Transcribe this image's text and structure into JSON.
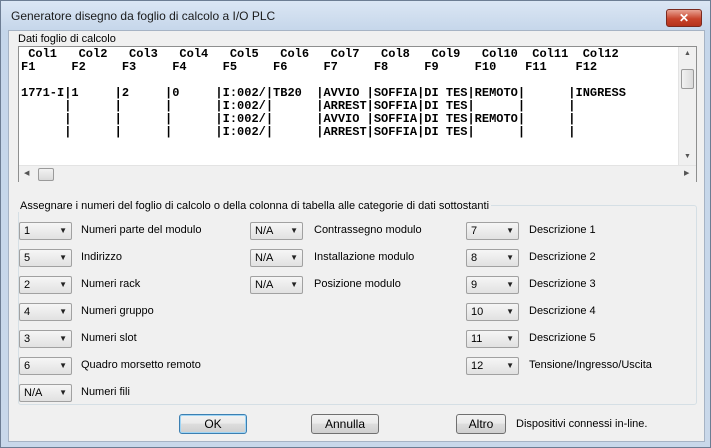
{
  "window": {
    "title": "Generatore disegno da foglio di calcolo a I/O PLC"
  },
  "icons": {
    "close": "close-icon",
    "scroll_up": "arrow-up-icon",
    "scroll_down": "arrow-down-icon",
    "scroll_left": "arrow-left-icon",
    "scroll_right": "arrow-right-icon",
    "dropdown": "chevron-down-icon"
  },
  "sheet": {
    "label": "Dati foglio di calcolo",
    "lines": [
      " Col1   Col2   Col3   Col4   Col5   Col6   Col7   Col8   Col9   Col10  Col11  Col12",
      "F1     F2     F3     F4     F5     F6     F7     F8     F9     F10    F11    F12",
      "",
      "1771-I|1     |2     |0     |I:002/|TB20  |AVVIO |SOFFIA|DI TES|REMOTO|      |INGRESS",
      "      |      |      |      |I:002/|      |ARREST|SOFFIA|DI TES|      |      |",
      "      |      |      |      |I:002/|      |AVVIO |SOFFIA|DI TES|REMOTO|      |",
      "      |      |      |      |I:002/|      |ARREST|SOFFIA|DI TES|      |      |"
    ]
  },
  "assign": {
    "title": "Assegnare i numeri del foglio di calcolo o della colonna di tabella alle categorie di dati sottostanti",
    "col1": [
      {
        "value": "1",
        "label": "Numeri parte del modulo"
      },
      {
        "value": "5",
        "label": "Indirizzo"
      },
      {
        "value": "2",
        "label": "Numeri rack"
      },
      {
        "value": "4",
        "label": "Numeri gruppo"
      },
      {
        "value": "3",
        "label": "Numeri slot"
      },
      {
        "value": "6",
        "label": "Quadro morsetto remoto"
      },
      {
        "value": "N/A",
        "label": "Numeri fili"
      }
    ],
    "col2": [
      {
        "value": "N/A",
        "label": "Contrassegno modulo"
      },
      {
        "value": "N/A",
        "label": "Installazione modulo"
      },
      {
        "value": "N/A",
        "label": "Posizione modulo"
      }
    ],
    "col3": [
      {
        "value": "7",
        "label": "Descrizione 1"
      },
      {
        "value": "8",
        "label": "Descrizione 2"
      },
      {
        "value": "9",
        "label": "Descrizione 3"
      },
      {
        "value": "10",
        "label": "Descrizione 4"
      },
      {
        "value": "11",
        "label": "Descrizione 5"
      },
      {
        "value": "12",
        "label": "Tensione/Ingresso/Uscita"
      }
    ]
  },
  "buttons": {
    "ok": "OK",
    "cancel": "Annulla",
    "other": "Altro",
    "other_note": "Dispositivi connessi in-line."
  }
}
